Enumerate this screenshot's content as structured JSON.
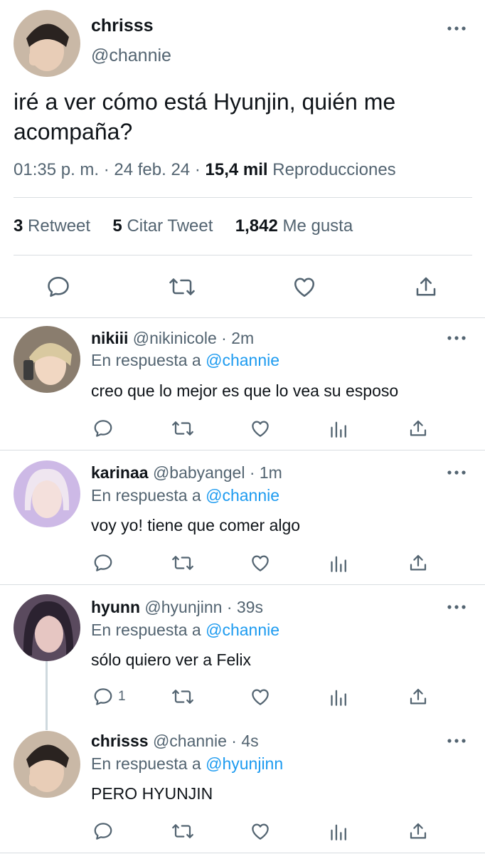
{
  "main_tweet": {
    "name": "chrisss",
    "handle": "@channie",
    "text": "iré a ver cómo está Hyunjin, quién me acompaña?",
    "time": "01:35 p. m. · 24 feb. 24 ·",
    "views_count": "15,4 mil",
    "views_label": "Reproducciones",
    "retweets_count": "3",
    "retweets_label": "Retweet",
    "quotes_count": "5",
    "quotes_label": "Citar Tweet",
    "likes_count": "1,842",
    "likes_label": "Me gusta"
  },
  "replies": [
    {
      "name": "nikiii",
      "handle": "@nikinicole",
      "time": "· 2m",
      "reply_prefix": "En respuesta a",
      "reply_to": "@channie",
      "text": "creo que lo mejor es que lo vea su esposo",
      "reply_count": ""
    },
    {
      "name": "karinaa",
      "handle": "@babyangel",
      "time": "· 1m",
      "reply_prefix": "En respuesta a",
      "reply_to": "@channie",
      "text": "voy yo! tiene que comer algo",
      "reply_count": ""
    },
    {
      "name": "hyunn",
      "handle": "@hyunjinn",
      "time": "· 39s",
      "reply_prefix": "En respuesta a",
      "reply_to": "@channie",
      "text": "sólo quiero ver a Felix",
      "reply_count": "1"
    },
    {
      "name": "chrisss",
      "handle": "@channie",
      "time": "· 4s",
      "reply_prefix": "En respuesta a",
      "reply_to": "@hyunjinn",
      "text": "PERO HYUNJIN",
      "reply_count": ""
    }
  ],
  "colors": {
    "accent": "#1d9bf0",
    "secondary_text": "#536471",
    "divider": "#d9dde1"
  },
  "icons": [
    "more-icon",
    "reply-icon",
    "retweet-icon",
    "like-icon",
    "share-icon",
    "views-icon"
  ]
}
